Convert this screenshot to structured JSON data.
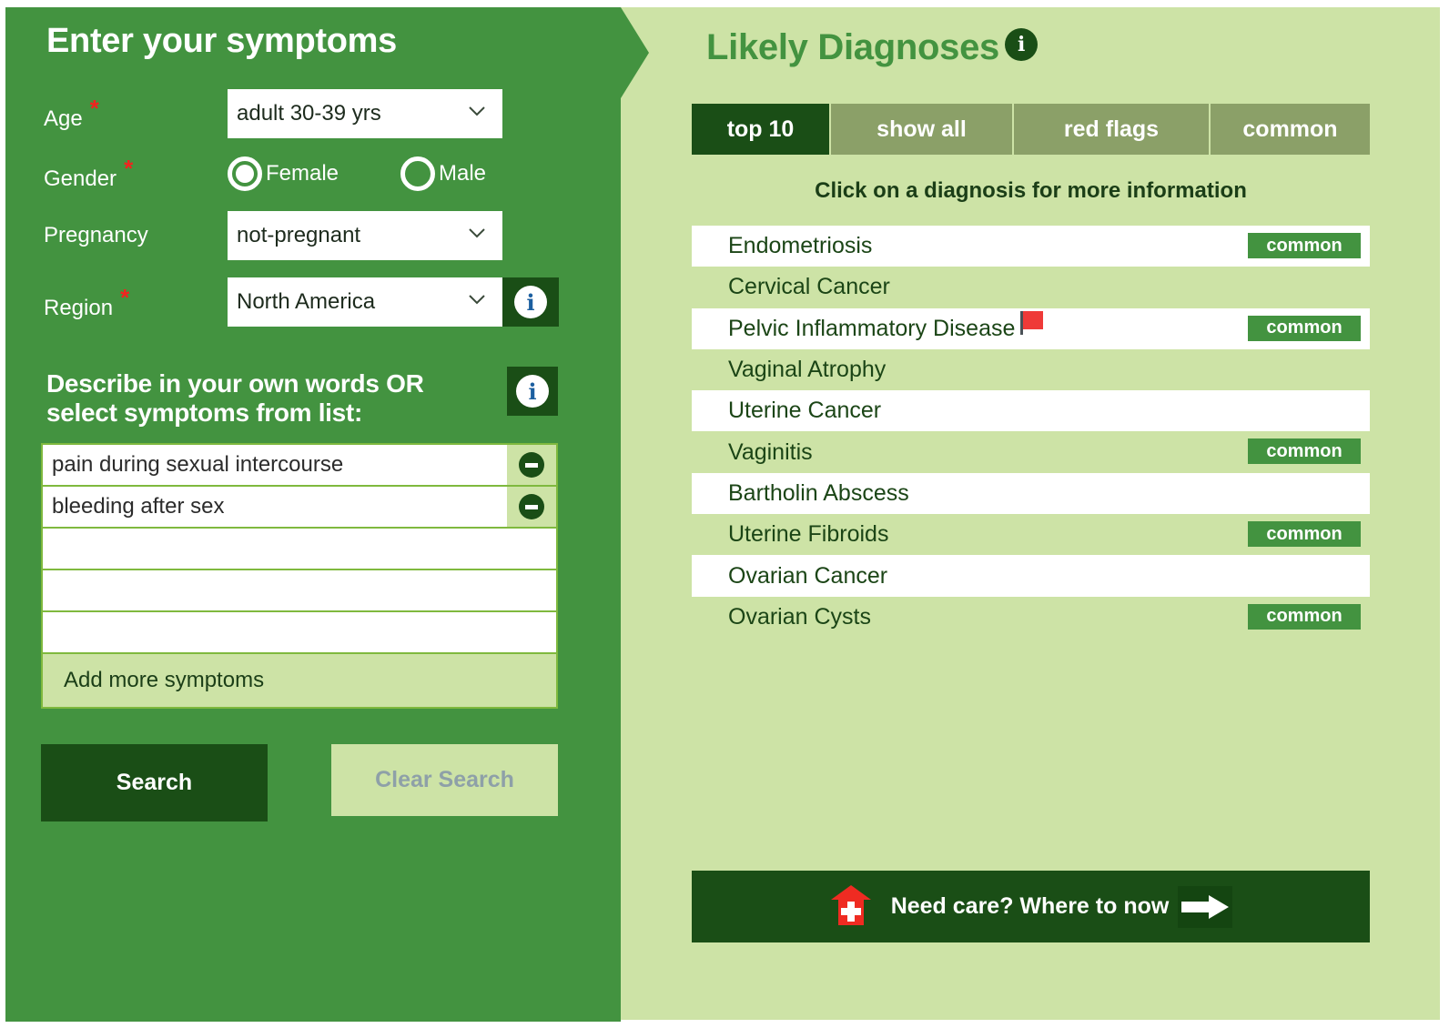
{
  "left": {
    "title": "Enter your symptoms",
    "fields": {
      "age": {
        "label": "Age",
        "required_mark": "*",
        "value": "adult 30-39 yrs"
      },
      "gender": {
        "label": "Gender",
        "required_mark": "*",
        "options": [
          {
            "label": "Female",
            "selected": true
          },
          {
            "label": "Male",
            "selected": false
          }
        ]
      },
      "pregnancy": {
        "label": "Pregnancy",
        "value": "not-pregnant"
      },
      "region": {
        "label": "Region",
        "required_mark": "*",
        "value": "North America"
      }
    },
    "describe_heading_line1": "Describe in your own words OR",
    "describe_heading_line2": "select symptoms from list:",
    "symptoms": [
      "pain during sexual intercourse",
      "bleeding after sex",
      "",
      "",
      ""
    ],
    "add_more_label": "Add more symptoms",
    "search_label": "Search",
    "clear_label": "Clear Search"
  },
  "right": {
    "title": "Likely Diagnoses",
    "tabs": [
      {
        "label": "top 10",
        "active": true
      },
      {
        "label": "show all",
        "active": false
      },
      {
        "label": "red flags",
        "active": false
      },
      {
        "label": "common",
        "active": false
      }
    ],
    "subtitle": "Click on a diagnosis for more information",
    "badge_label": "common",
    "diagnoses": [
      {
        "name": "Endometriosis",
        "common": true,
        "red_flag": false
      },
      {
        "name": "Cervical Cancer",
        "common": false,
        "red_flag": false
      },
      {
        "name": "Pelvic Inflammatory Disease",
        "common": true,
        "red_flag": true
      },
      {
        "name": "Vaginal Atrophy",
        "common": false,
        "red_flag": false
      },
      {
        "name": "Uterine Cancer",
        "common": false,
        "red_flag": false
      },
      {
        "name": "Vaginitis",
        "common": true,
        "red_flag": false
      },
      {
        "name": "Bartholin Abscess",
        "common": false,
        "red_flag": false
      },
      {
        "name": "Uterine Fibroids",
        "common": true,
        "red_flag": false
      },
      {
        "name": "Ovarian Cancer",
        "common": false,
        "red_flag": false
      },
      {
        "name": "Ovarian Cysts",
        "common": true,
        "red_flag": false
      }
    ],
    "care_button_label": "Need care?  Where to now"
  },
  "colors": {
    "primary_green": "#439340",
    "dark_green": "#1a4e16",
    "light_green": "#cde3a6",
    "tab_inactive": "#8ba068",
    "required_red": "#f2231f",
    "flag_red": "#ef3a38"
  }
}
